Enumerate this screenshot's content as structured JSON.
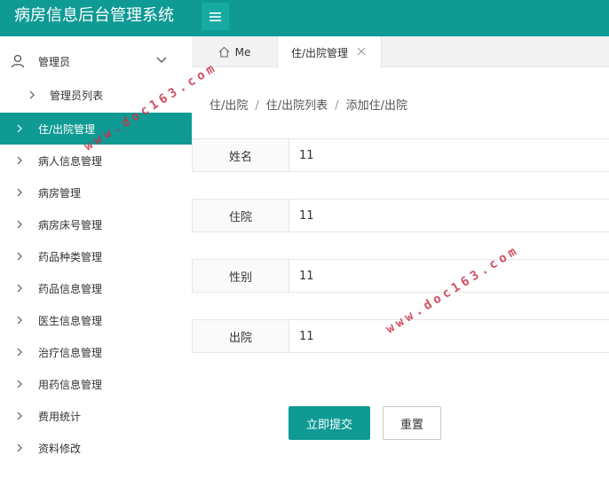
{
  "header": {
    "title": "病房信息后台管理系统"
  },
  "sidebar": {
    "group": {
      "label": "管理员"
    },
    "items": [
      {
        "label": "管理员列表"
      },
      {
        "label": "住/出院管理"
      },
      {
        "label": "病人信息管理"
      },
      {
        "label": "病房管理"
      },
      {
        "label": "病房床号管理"
      },
      {
        "label": "药品种类管理"
      },
      {
        "label": "药品信息管理"
      },
      {
        "label": "医生信息管理"
      },
      {
        "label": "治疗信息管理"
      },
      {
        "label": "用药信息管理"
      },
      {
        "label": "费用统计"
      },
      {
        "label": "资料修改"
      }
    ]
  },
  "tabs": {
    "home": "Me",
    "active": "住/出院管理"
  },
  "breadcrumb": [
    "住/出院",
    "住/出院列表",
    "添加住/出院"
  ],
  "form": {
    "fields": [
      {
        "label": "姓名",
        "value": "11"
      },
      {
        "label": "住院",
        "value": "11"
      },
      {
        "label": "性别",
        "value": "11"
      },
      {
        "label": "出院",
        "value": "11"
      }
    ],
    "submit_label": "立即提交",
    "reset_label": "重置"
  },
  "watermarks": [
    "www.doc163.com",
    "www.doc163.com"
  ],
  "colors": {
    "accent": "#0f9a94",
    "header": "#0f9a94"
  }
}
